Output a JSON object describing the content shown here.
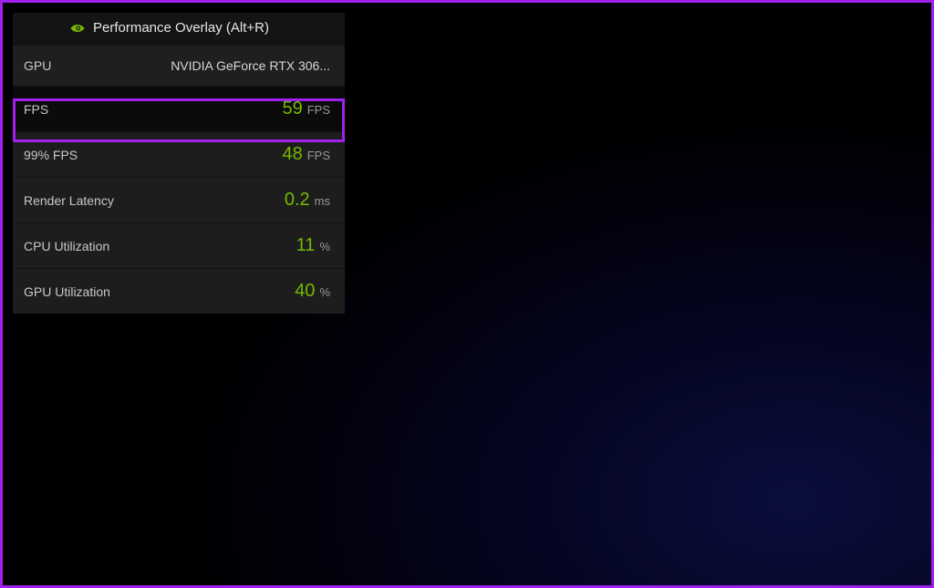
{
  "overlay": {
    "title": "Performance Overlay (Alt+R)",
    "rows": {
      "gpu": {
        "label": "GPU",
        "value": "NVIDIA GeForce RTX 306..."
      },
      "fps": {
        "label": "FPS",
        "value": "59",
        "unit": "FPS"
      },
      "fps99": {
        "label": "99% FPS",
        "value": "48",
        "unit": "FPS"
      },
      "render_latency": {
        "label": "Render Latency",
        "value": "0.2",
        "unit": "ms"
      },
      "cpu_util": {
        "label": "CPU Utilization",
        "value": "11",
        "unit": "%"
      },
      "gpu_util": {
        "label": "GPU Utilization",
        "value": "40",
        "unit": "%"
      }
    }
  },
  "colors": {
    "accent": "#76b900",
    "highlight": "#a020f0"
  }
}
